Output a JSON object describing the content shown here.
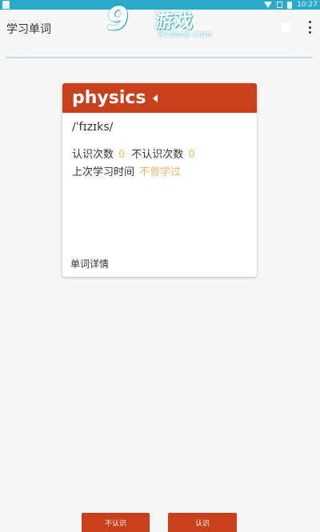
{
  "status_bar": {
    "time": "10:27"
  },
  "app_bar": {
    "title": "学习单词"
  },
  "watermark": {
    "logo": "9",
    "brand": "游戏",
    "url": "91danji.com"
  },
  "card": {
    "word": "physics",
    "phonetic": "/ˈfɪzɪks/",
    "known_label": "认识次数",
    "known_count": "0",
    "unknown_label": "不认识次数",
    "unknown_count": "0",
    "last_study_label": "上次学习时间",
    "last_study_value": "不曾学过",
    "detail_label": "单词详情"
  },
  "buttons": {
    "unknown": "不认识",
    "known": "认识"
  },
  "colors": {
    "accent": "#c9411c",
    "statusbar": "#2aa9c9",
    "highlight": "#f5b461"
  }
}
